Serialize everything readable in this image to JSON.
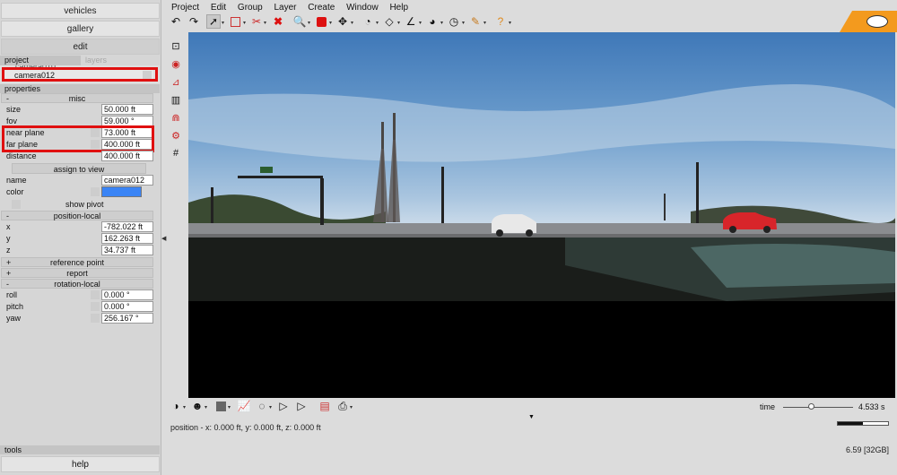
{
  "left_panel": {
    "top_buttons": [
      "vehicles",
      "gallery",
      "edit"
    ],
    "tabs": {
      "project": "project",
      "layers": "layers"
    },
    "list": {
      "ghost_item": "camera010",
      "selected_item": "camera012"
    },
    "properties_header": "properties",
    "misc": {
      "sign": "-",
      "label": "misc",
      "rows": [
        {
          "label": "size",
          "value": "50.000 ft"
        },
        {
          "label": "fov",
          "value": "59.000 °"
        },
        {
          "label": "near plane",
          "value": "73.000 ft"
        },
        {
          "label": "far plane",
          "value": "400.000 ft"
        },
        {
          "label": "distance",
          "value": "400.000 ft"
        }
      ],
      "assign_button": "assign to view",
      "name_label": "name",
      "name_value": "camera012",
      "color_label": "color",
      "color_value": "#3a84f5",
      "show_pivot": "show pivot"
    },
    "position_local": {
      "sign": "-",
      "label": "position-local",
      "rows": [
        {
          "label": "x",
          "value": "-782.022 ft"
        },
        {
          "label": "y",
          "value": "162.263 ft"
        },
        {
          "label": "z",
          "value": "34.737 ft"
        }
      ]
    },
    "reference_point": {
      "sign": "+",
      "label": "reference point"
    },
    "report": {
      "sign": "+",
      "label": "report"
    },
    "rotation_local": {
      "sign": "-",
      "label": "rotation-local",
      "rows": [
        {
          "label": "roll",
          "value": "0.000 °"
        },
        {
          "label": "pitch",
          "value": "0.000 °"
        },
        {
          "label": "yaw",
          "value": "256.167 °"
        }
      ]
    },
    "tools_header": "tools",
    "help_button": "help"
  },
  "menu": [
    "Project",
    "Edit",
    "Group",
    "Layer",
    "Create",
    "Window",
    "Help"
  ],
  "toolbar_icons": [
    "undo-icon",
    "redo-icon",
    "select-arrow-icon",
    "rectangle-select-icon",
    "scissors-icon",
    "delete-icon",
    "zoom-icon",
    "red-box-icon",
    "move-icon",
    "measure-icon",
    "plane-icon",
    "angle-icon",
    "gauge-icon",
    "timer-icon",
    "pencil-icon",
    "help-icon"
  ],
  "timeline": {
    "label": "time",
    "value": "4.533 s",
    "position": 0.4
  },
  "status": {
    "position_text": "position - x: 0.000 ft, y: 0.000 ft, z: 0.000 ft",
    "memory": "6.59 [32GB]"
  },
  "progress": 0.5,
  "colors": {
    "accent_orange": "#f39a1e",
    "highlight_red": "#e01010",
    "car_red": "#d8252a"
  }
}
